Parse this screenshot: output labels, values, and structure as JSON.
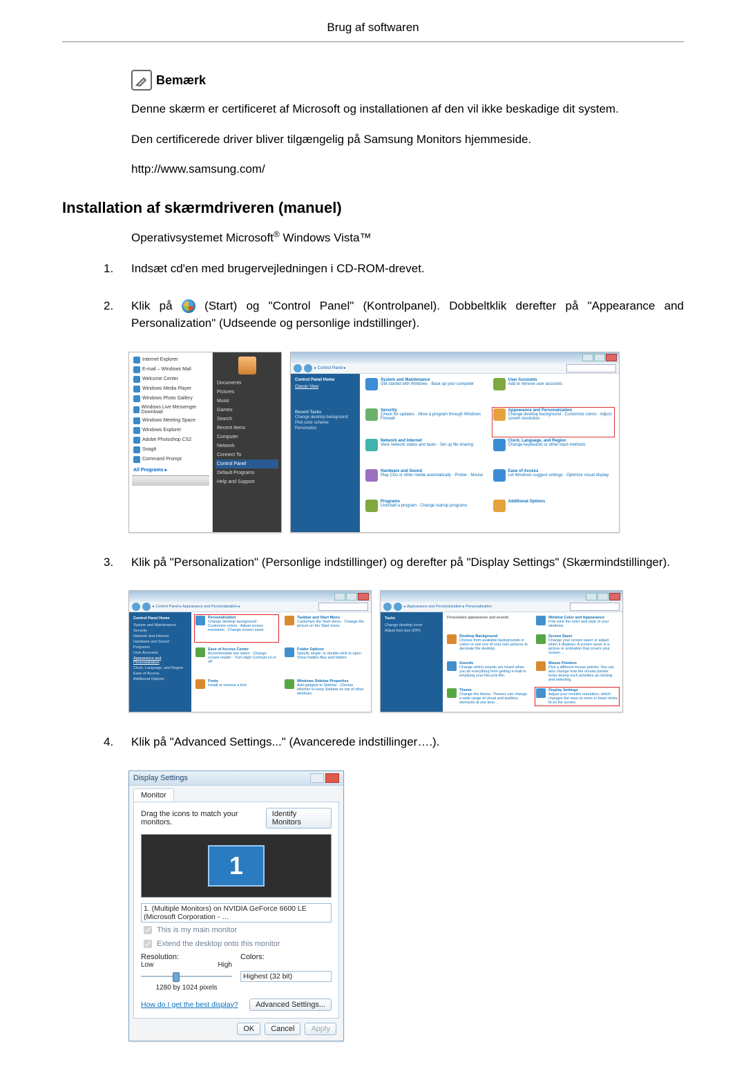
{
  "header": {
    "title": "Brug af softwaren"
  },
  "note": {
    "label": "Bemærk",
    "p1": "Denne skærm er certificeret af Microsoft og installationen af den vil ikke beskadige dit system.",
    "p2": "Den certificerede driver bliver tilgængelig på Samsung Monitors hjemmeside.",
    "url": "http://www.samsung.com/"
  },
  "section": {
    "heading": "Installation af skærmdriveren (manuel)",
    "os_prefix": "Operativsystemet Microsoft",
    "os_suffix": " Windows Vista™"
  },
  "steps": {
    "s1": {
      "num": "1.",
      "text": "Indsæt cd'en med brugervejledningen i CD-ROM-drevet."
    },
    "s2": {
      "num": "2.",
      "prefix": "Klik på ",
      "mid": "(Start) og \"Control Panel\" (Kontrolpanel). Dobbeltklik derefter på \"Appearance and Personalization\" (Udseende og personlige indstillinger)."
    },
    "s3": {
      "num": "3.",
      "text": "Klik på \"Personalization\" (Personlige indstillinger) og derefter på \"Display Settings\" (Skærmindstillinger)."
    },
    "s4": {
      "num": "4.",
      "text": "Klik på \"Advanced Settings...\" (Avancerede indstillinger….)."
    }
  },
  "startmenu": {
    "left": {
      "items": [
        "Internet Explorer",
        "E-mail – Windows Mail",
        "Welcome Center",
        "Windows Media Player",
        "Windows Photo Gallery",
        "Windows Live Messenger Download",
        "Windows Meeting Space",
        "Windows Explorer",
        "Adobe Photoshop CS2",
        "SnagIt",
        "Command Prompt"
      ],
      "all_programs": "All Programs"
    },
    "right": {
      "items": [
        "Documents",
        "Pictures",
        "Music",
        "Games",
        "Search",
        "Recent Items",
        "Computer",
        "Network",
        "Connect To",
        "Control Panel",
        "Default Programs",
        "Help and Support"
      ],
      "highlight_index": 9
    }
  },
  "control_panel": {
    "crumb": "▸ Control Panel ▸",
    "side_head": "Control Panel Home",
    "side_items": [
      "Classic View"
    ],
    "recent_head": "Recent Tasks",
    "recent_items": [
      "Change desktop background",
      "Pick color scheme",
      "Personalize"
    ],
    "cats": [
      {
        "h": "System and Maintenance",
        "s": "Get started with Windows · Back up your computer"
      },
      {
        "h": "User Accounts",
        "s": "Add or remove user accounts"
      },
      {
        "h": "Security",
        "s": "Check for updates · Allow a program through Windows Firewall"
      },
      {
        "h": "Appearance and Personalization",
        "s": "Change desktop background · Customize colors · Adjust screen resolution"
      },
      {
        "h": "Network and Internet",
        "s": "View network status and tasks · Set up file sharing"
      },
      {
        "h": "Clock, Language, and Region",
        "s": "Change keyboards or other input methods"
      },
      {
        "h": "Hardware and Sound",
        "s": "Play CDs or other media automatically · Printer · Mouse"
      },
      {
        "h": "Ease of Access",
        "s": "Let Windows suggest settings · Optimize visual display"
      },
      {
        "h": "Programs",
        "s": "Uninstall a program · Change startup programs"
      },
      {
        "h": "Additional Options",
        "s": ""
      }
    ],
    "highlight_index": 3
  },
  "appearance": {
    "crumb": "▸ Control Panel ▸ Appearance and Personalization ▸",
    "items": [
      {
        "h": "Personalization",
        "s": "Change desktop background · Customize colors · Adjust screen resolution · Change screen saver"
      },
      {
        "h": "Taskbar and Start Menu",
        "s": "Customize the Start menu · Change the picture on the Start menu"
      },
      {
        "h": "Ease of Access Center",
        "s": "Accommodate low vision · Change screen reader · Turn High Contrast on or off"
      },
      {
        "h": "Folder Options",
        "s": "Specify single- or double-click to open · Show hidden files and folders"
      },
      {
        "h": "Fonts",
        "s": "Install or remove a font"
      },
      {
        "h": "Windows Sidebar Properties",
        "s": "Add gadgets to Sidebar · Choose whether to keep Sidebar on top of other windows"
      }
    ],
    "highlight_index": 0
  },
  "personalization": {
    "crumb": "▸ Appearance and Personalization ▸ Personalization",
    "head": "Personalize appearance and sounds",
    "items": [
      {
        "h": "Window Color and Appearance",
        "s": "Fine tune the color and style of your windows."
      },
      {
        "h": "Desktop Background",
        "s": "Choose from available backgrounds or colors or use one of your own pictures to decorate the desktop."
      },
      {
        "h": "Screen Saver",
        "s": "Change your screen saver or adjust when it displays. A screen saver is a picture or animation that covers your screen…"
      },
      {
        "h": "Sounds",
        "s": "Change which sounds are heard when you do everything from getting e-mail to emptying your Recycle Bin."
      },
      {
        "h": "Mouse Pointers",
        "s": "Pick a different mouse pointer. You can also change how the mouse pointer looks during such activities as clicking and selecting."
      },
      {
        "h": "Theme",
        "s": "Change the theme. Themes can change a wide range of visual and auditory elements at one time…"
      },
      {
        "h": "Display Settings",
        "s": "Adjust your monitor resolution, which changes the view so more or fewer items fit on the screen."
      }
    ],
    "highlight_index": 6
  },
  "display_settings": {
    "title": "Display Settings",
    "tab": "Monitor",
    "drag_label": "Drag the icons to match your monitors.",
    "identify": "Identify Monitors",
    "monitor_num": "1",
    "device": "1. (Multiple Monitors) on NVIDIA GeForce 6600 LE (Microsoft Corporation - …",
    "chk_main": "This is my main monitor",
    "chk_extend": "Extend the desktop onto this monitor",
    "res_label": "Resolution:",
    "low": "Low",
    "high": "High",
    "res_value": "1280 by 1024 pixels",
    "col_label": "Colors:",
    "col_value": "Highest (32 bit)",
    "howlink": "How do I get the best display?",
    "advanced": "Advanced Settings...",
    "ok": "OK",
    "cancel": "Cancel",
    "apply": "Apply"
  }
}
